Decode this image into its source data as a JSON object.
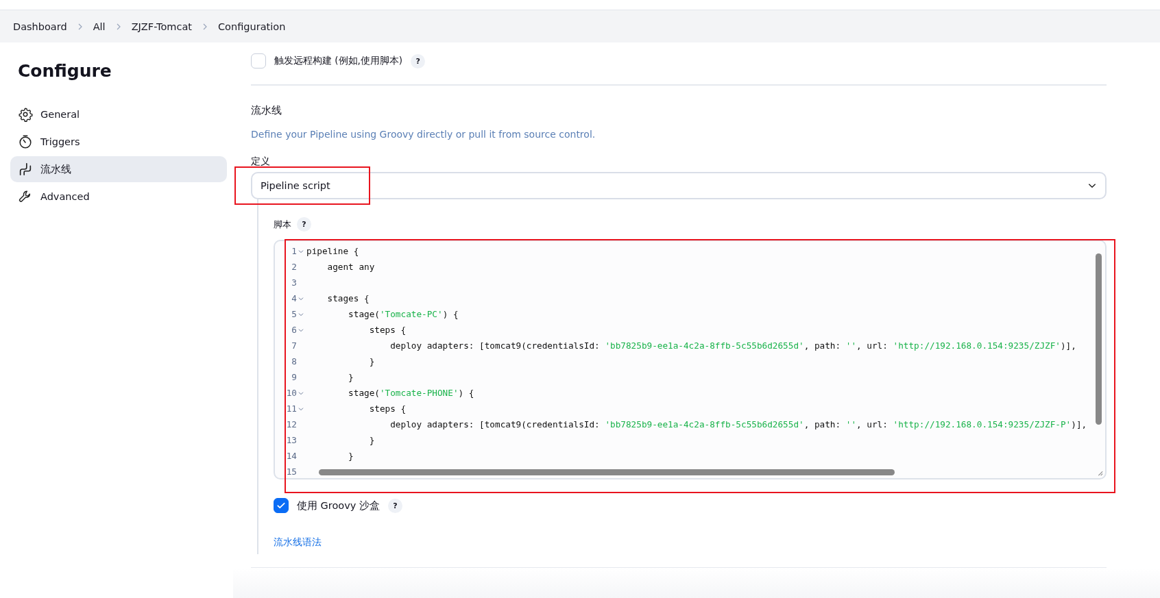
{
  "breadcrumbs": [
    {
      "label": "Dashboard"
    },
    {
      "label": "All"
    },
    {
      "label": "ZJZF-Tomcat"
    },
    {
      "label": "Configuration"
    }
  ],
  "sidebar": {
    "title": "Configure",
    "items": [
      {
        "label": "General",
        "kind": "gear",
        "selected": false
      },
      {
        "label": "Triggers",
        "kind": "timer",
        "selected": false
      },
      {
        "label": "流水线",
        "kind": "pipe",
        "selected": true
      },
      {
        "label": "Advanced",
        "kind": "wrench",
        "selected": false
      }
    ]
  },
  "remote_trigger": {
    "label": "触发远程构建 (例如,使用脚本)",
    "checked": false,
    "help": "?"
  },
  "pipeline": {
    "heading": "流水线",
    "description": "Define your Pipeline using Groovy directly or pull it from source control.",
    "definition_label": "定义",
    "definition": {
      "value": "Pipeline script",
      "highlighted": true
    },
    "script_label": "脚本",
    "script_help": "?",
    "editor": {
      "highlighted": true,
      "lines": [
        {
          "number": "1",
          "foldable": true,
          "tokens": [
            {
              "kind": "plain",
              "text": "pipeline {"
            }
          ]
        },
        {
          "number": "2",
          "foldable": false,
          "tokens": [
            {
              "kind": "plain",
              "text": "    agent any"
            }
          ]
        },
        {
          "number": "3",
          "foldable": false
        },
        {
          "number": "4",
          "foldable": true,
          "tokens": [
            {
              "kind": "plain",
              "text": "    stages {"
            }
          ]
        },
        {
          "number": "5",
          "foldable": true,
          "tokens": [
            {
              "kind": "plain",
              "text": "        stage("
            },
            {
              "kind": "string",
              "text": "'Tomcate-PC'"
            },
            {
              "kind": "plain",
              "text": ") {"
            }
          ]
        },
        {
          "number": "6",
          "foldable": true,
          "tokens": [
            {
              "kind": "plain",
              "text": "            steps {"
            }
          ]
        },
        {
          "number": "7",
          "foldable": false,
          "tokens": [
            {
              "kind": "plain",
              "text": "                deploy adapters: [tomcat9(credentialsId: "
            },
            {
              "kind": "string",
              "text": "'bb7825b9-ee1a-4c2a-8ffb-5c55b6d2655d'"
            },
            {
              "kind": "plain",
              "text": ", path: "
            },
            {
              "kind": "string",
              "text": "''"
            },
            {
              "kind": "plain",
              "text": ", url: "
            },
            {
              "kind": "string",
              "text": "'http://192.168.0.154:9235/ZJZF'"
            },
            {
              "kind": "plain",
              "text": ")],"
            }
          ]
        },
        {
          "number": "8",
          "foldable": false,
          "tokens": [
            {
              "kind": "plain",
              "text": "            }"
            }
          ]
        },
        {
          "number": "9",
          "foldable": false,
          "tokens": [
            {
              "kind": "plain",
              "text": "        }"
            }
          ]
        },
        {
          "number": "10",
          "foldable": true,
          "tokens": [
            {
              "kind": "plain",
              "text": "        stage("
            },
            {
              "kind": "string",
              "text": "'Tomcate-PHONE'"
            },
            {
              "kind": "plain",
              "text": ") {"
            }
          ]
        },
        {
          "number": "11",
          "foldable": true,
          "tokens": [
            {
              "kind": "plain",
              "text": "            steps {"
            }
          ]
        },
        {
          "number": "12",
          "foldable": false,
          "tokens": [
            {
              "kind": "plain",
              "text": "                deploy adapters: [tomcat9(credentialsId: "
            },
            {
              "kind": "string",
              "text": "'bb7825b9-ee1a-4c2a-8ffb-5c55b6d2655d'"
            },
            {
              "kind": "plain",
              "text": ", path: "
            },
            {
              "kind": "string",
              "text": "''"
            },
            {
              "kind": "plain",
              "text": ", url: "
            },
            {
              "kind": "string",
              "text": "'http://192.168.0.154:9235/ZJZF-P'"
            },
            {
              "kind": "plain",
              "text": ")],"
            }
          ]
        },
        {
          "number": "13",
          "foldable": false,
          "tokens": [
            {
              "kind": "plain",
              "text": "            }"
            }
          ]
        },
        {
          "number": "14",
          "foldable": false,
          "tokens": [
            {
              "kind": "plain",
              "text": "        }"
            }
          ]
        },
        {
          "number": "15",
          "foldable": false
        }
      ]
    },
    "sandbox": {
      "label": "使用 Groovy 沙盒",
      "checked": true,
      "help": "?"
    },
    "syntax_link": "流水线语法"
  }
}
